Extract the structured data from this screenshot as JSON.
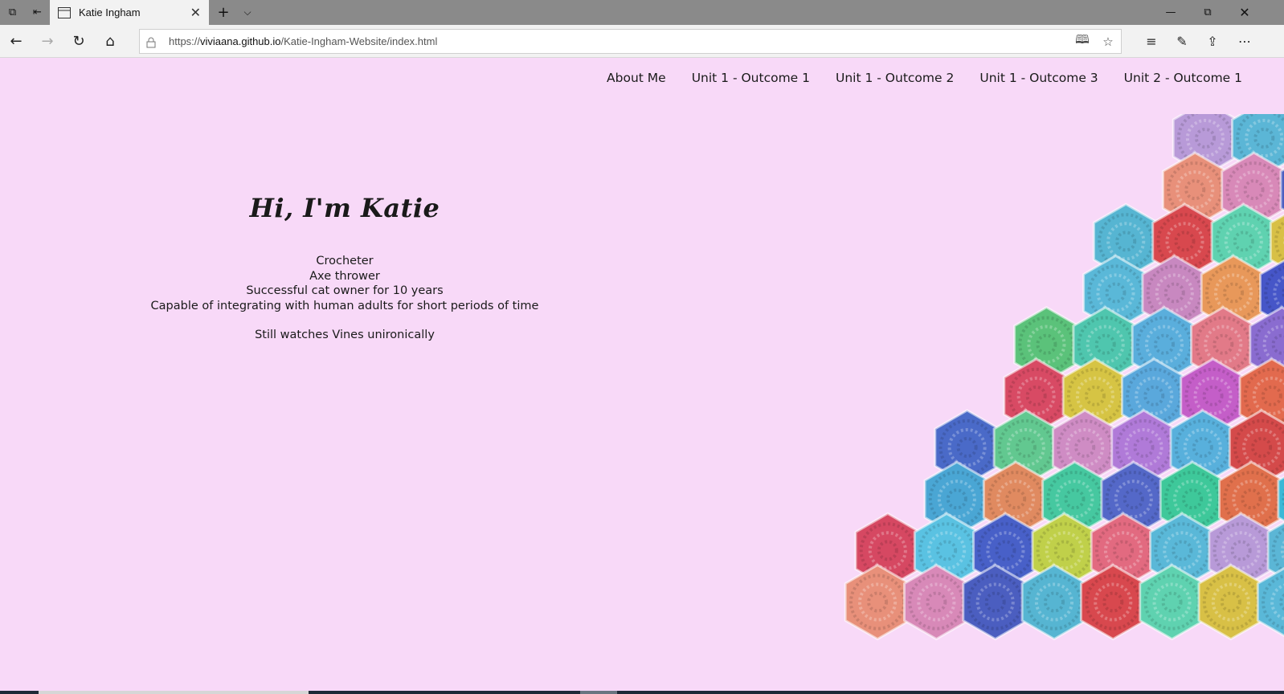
{
  "browser": {
    "tab_title": "Katie Ingham",
    "url_domain": "viviaana.github.io",
    "url_prefix": "https://",
    "url_path": "/Katie-Ingham-Website/index.html"
  },
  "nav": {
    "items": [
      {
        "label": "About Me"
      },
      {
        "label": "Unit 1 - Outcome 1"
      },
      {
        "label": "Unit 1 - Outcome 2"
      },
      {
        "label": "Unit 1 - Outcome 3"
      },
      {
        "label": "Unit 2 - Outcome 1"
      }
    ]
  },
  "hero": {
    "heading": "Hi, I'm Katie",
    "lines": [
      "Crocheter",
      "Axe thrower",
      "Successful cat owner for 10 years",
      "Capable of integrating with human adults for short periods of time"
    ],
    "extra": "Still watches Vines unironically"
  },
  "colors": {
    "background": "#f8d9f8",
    "hexes": [
      "#b89ad8",
      "#5bb6d6",
      "#e8907a",
      "#d889b8",
      "#4b5ec0",
      "#56b5d2",
      "#d8484e",
      "#5fd2b0",
      "#d8c046",
      "#5ab8d8",
      "#c888c0",
      "#e8985a",
      "#4656c8",
      "#5bc27a",
      "#4fc6ae",
      "#5aaedc",
      "#e27a88",
      "#8a6cd0",
      "#d84a64",
      "#d6c444",
      "#5aa8dc",
      "#c45ec8",
      "#e26a4e",
      "#4a6ac8",
      "#62c890",
      "#cf8cc4",
      "#b07ad8",
      "#58b0dc",
      "#d44a4a",
      "#4aa6d4",
      "#e08a60",
      "#46c8a0",
      "#5468c8",
      "#3ec89a",
      "#e0704c",
      "#3ab8d6",
      "#d64862",
      "#5ac2e2",
      "#4860c8",
      "#c0d04a",
      "#e26a80",
      "#5ab8d8"
    ]
  }
}
